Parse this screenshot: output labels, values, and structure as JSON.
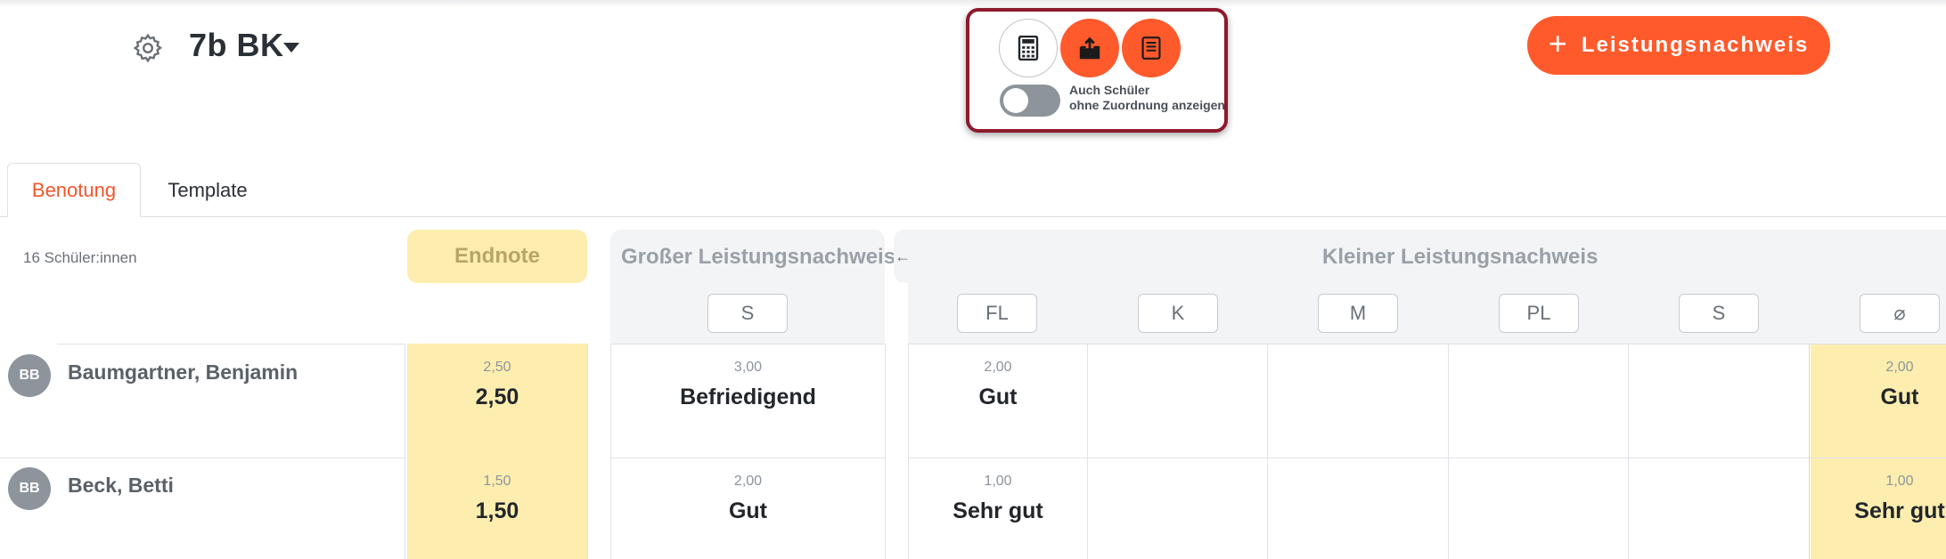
{
  "header": {
    "class_name": "7b BK"
  },
  "toolbar": {
    "toggle_label_line1": "Auch Schüler",
    "toggle_label_line2": "ohne Zuordnung anzeigen",
    "toggle_on": false
  },
  "add_button": {
    "label": "Leistungsnachweis"
  },
  "tabs": [
    {
      "label": "Benotung",
      "active": true
    },
    {
      "label": "Template",
      "active": false
    }
  ],
  "table": {
    "student_count": "16 Schüler:innen",
    "endnote_header": "Endnote",
    "group_large": {
      "title": "Großer Leistungsnachweis",
      "columns": [
        "S"
      ]
    },
    "group_small": {
      "title": "Kleiner Leistungsnachweis",
      "columns": [
        "FL",
        "K",
        "M",
        "PL",
        "S",
        "⌀"
      ]
    },
    "students": [
      {
        "initials": "BB",
        "name": "Baumgartner, Benjamin",
        "endnote": {
          "num": "2,50",
          "label": "2,50"
        },
        "large_s": {
          "num": "3,00",
          "label": "Befriedigend"
        },
        "small_fl": {
          "num": "2,00",
          "label": "Gut"
        },
        "small_avg": {
          "num": "2,00",
          "label": "Gut"
        }
      },
      {
        "initials": "BB",
        "name": "Beck, Betti",
        "endnote": {
          "num": "1,50",
          "label": "1,50"
        },
        "large_s": {
          "num": "2,00",
          "label": "Gut"
        },
        "small_fl": {
          "num": "1,00",
          "label": "Sehr gut"
        },
        "small_avg": {
          "num": "1,00",
          "label": "Sehr gut"
        }
      }
    ]
  },
  "colors": {
    "accent": "#ff5a2c",
    "highlight_border": "#8c1a2b",
    "endnote_bg": "#fdeeb0"
  },
  "icons": [
    "gear-icon",
    "caret-down-icon",
    "calculator-icon",
    "export-icon",
    "report-icon",
    "plus-icon",
    "arrow-left-icon"
  ]
}
